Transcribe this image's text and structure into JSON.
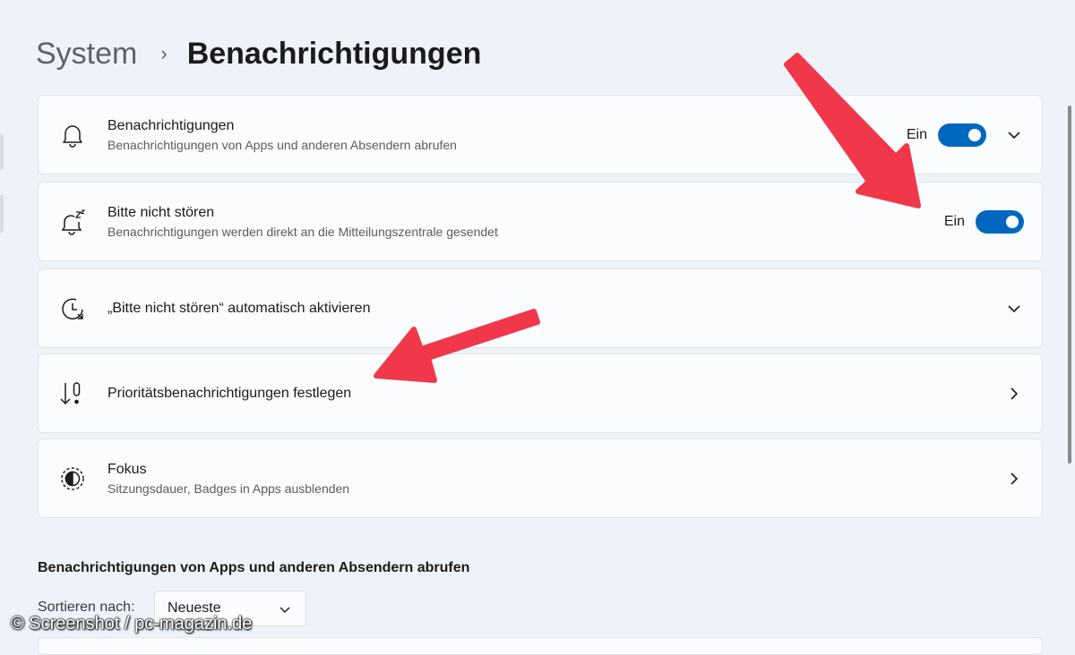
{
  "breadcrumb": {
    "parent": "System",
    "separator": "›",
    "current": "Benachrichtigungen"
  },
  "cards": [
    {
      "icon": "bell-icon",
      "title": "Benachrichtigungen",
      "subtitle": "Benachrichtigungen von Apps und anderen Absendern abrufen",
      "state": "Ein",
      "toggle_on": true,
      "control": "chevron-down"
    },
    {
      "icon": "bell-snooze-icon",
      "title": "Bitte nicht stören",
      "subtitle": "Benachrichtigungen werden direkt an die Mitteilungszentrale gesendet",
      "state": "Ein",
      "toggle_on": true
    },
    {
      "icon": "clock-schedule-icon",
      "title": "„Bitte nicht stören“ automatisch aktivieren",
      "control": "chevron-down"
    },
    {
      "icon": "priority-sort-icon",
      "title": "Prioritätsbenachrichtigungen festlegen",
      "control": "chevron-right"
    },
    {
      "icon": "focus-icon",
      "title": "Fokus",
      "subtitle": "Sitzungsdauer, Badges in Apps ausblenden",
      "control": "chevron-right"
    }
  ],
  "apps_section": {
    "title": "Benachrichtigungen von Apps und anderen Absendern abrufen",
    "sort_label": "Sortieren nach:",
    "sort_value": "Neueste"
  },
  "watermark": "© Screenshot / pc-magazin.de",
  "colors": {
    "accent": "#0067c0",
    "annotation_arrow": "#f0384a",
    "background": "#eef2f9"
  }
}
